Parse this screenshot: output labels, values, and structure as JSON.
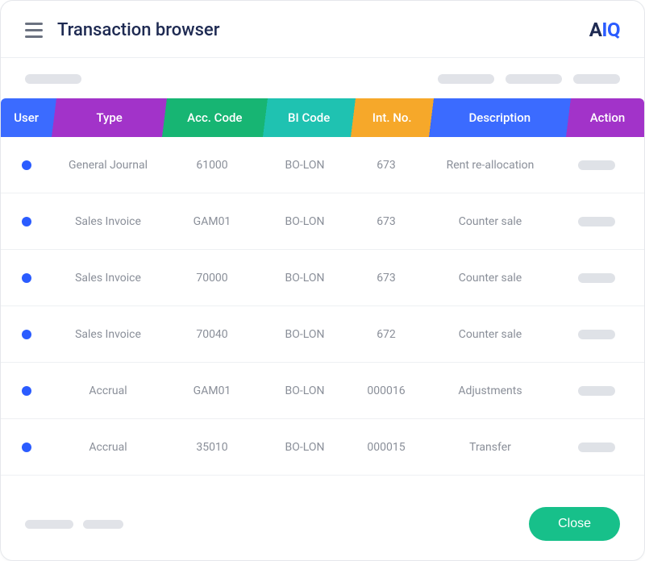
{
  "header": {
    "title": "Transaction browser",
    "logo_a": "A",
    "logo_iq": "IQ"
  },
  "columns": {
    "user": "User",
    "type": "Type",
    "acc_code": "Acc. Code",
    "bi_code": "BI Code",
    "int_no": "Int. No.",
    "description": "Description",
    "action": "Action"
  },
  "rows": [
    {
      "type": "General Journal",
      "acc_code": "61000",
      "bi_code": "BO-LON",
      "int_no": "673",
      "description": "Rent re-allocation"
    },
    {
      "type": "Sales Invoice",
      "acc_code": "GAM01",
      "bi_code": "BO-LON",
      "int_no": "673",
      "description": "Counter sale"
    },
    {
      "type": "Sales Invoice",
      "acc_code": "70000",
      "bi_code": "BO-LON",
      "int_no": "673",
      "description": "Counter sale"
    },
    {
      "type": "Sales Invoice",
      "acc_code": "70040",
      "bi_code": "BO-LON",
      "int_no": "672",
      "description": "Counter sale"
    },
    {
      "type": "Accrual",
      "acc_code": "GAM01",
      "bi_code": "BO-LON",
      "int_no": "000016",
      "description": "Adjustments"
    },
    {
      "type": "Accrual",
      "acc_code": "35010",
      "bi_code": "BO-LON",
      "int_no": "000015",
      "description": "Transfer"
    }
  ],
  "footer": {
    "close_label": "Close"
  }
}
